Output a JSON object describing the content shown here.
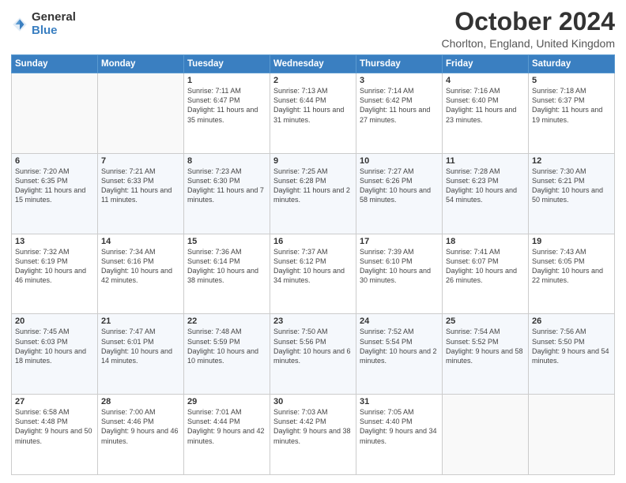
{
  "header": {
    "logo_general": "General",
    "logo_blue": "Blue",
    "month_title": "October 2024",
    "location": "Chorlton, England, United Kingdom"
  },
  "days_of_week": [
    "Sunday",
    "Monday",
    "Tuesday",
    "Wednesday",
    "Thursday",
    "Friday",
    "Saturday"
  ],
  "weeks": [
    [
      {
        "num": "",
        "info": ""
      },
      {
        "num": "",
        "info": ""
      },
      {
        "num": "1",
        "info": "Sunrise: 7:11 AM\nSunset: 6:47 PM\nDaylight: 11 hours and 35 minutes."
      },
      {
        "num": "2",
        "info": "Sunrise: 7:13 AM\nSunset: 6:44 PM\nDaylight: 11 hours and 31 minutes."
      },
      {
        "num": "3",
        "info": "Sunrise: 7:14 AM\nSunset: 6:42 PM\nDaylight: 11 hours and 27 minutes."
      },
      {
        "num": "4",
        "info": "Sunrise: 7:16 AM\nSunset: 6:40 PM\nDaylight: 11 hours and 23 minutes."
      },
      {
        "num": "5",
        "info": "Sunrise: 7:18 AM\nSunset: 6:37 PM\nDaylight: 11 hours and 19 minutes."
      }
    ],
    [
      {
        "num": "6",
        "info": "Sunrise: 7:20 AM\nSunset: 6:35 PM\nDaylight: 11 hours and 15 minutes."
      },
      {
        "num": "7",
        "info": "Sunrise: 7:21 AM\nSunset: 6:33 PM\nDaylight: 11 hours and 11 minutes."
      },
      {
        "num": "8",
        "info": "Sunrise: 7:23 AM\nSunset: 6:30 PM\nDaylight: 11 hours and 7 minutes."
      },
      {
        "num": "9",
        "info": "Sunrise: 7:25 AM\nSunset: 6:28 PM\nDaylight: 11 hours and 2 minutes."
      },
      {
        "num": "10",
        "info": "Sunrise: 7:27 AM\nSunset: 6:26 PM\nDaylight: 10 hours and 58 minutes."
      },
      {
        "num": "11",
        "info": "Sunrise: 7:28 AM\nSunset: 6:23 PM\nDaylight: 10 hours and 54 minutes."
      },
      {
        "num": "12",
        "info": "Sunrise: 7:30 AM\nSunset: 6:21 PM\nDaylight: 10 hours and 50 minutes."
      }
    ],
    [
      {
        "num": "13",
        "info": "Sunrise: 7:32 AM\nSunset: 6:19 PM\nDaylight: 10 hours and 46 minutes."
      },
      {
        "num": "14",
        "info": "Sunrise: 7:34 AM\nSunset: 6:16 PM\nDaylight: 10 hours and 42 minutes."
      },
      {
        "num": "15",
        "info": "Sunrise: 7:36 AM\nSunset: 6:14 PM\nDaylight: 10 hours and 38 minutes."
      },
      {
        "num": "16",
        "info": "Sunrise: 7:37 AM\nSunset: 6:12 PM\nDaylight: 10 hours and 34 minutes."
      },
      {
        "num": "17",
        "info": "Sunrise: 7:39 AM\nSunset: 6:10 PM\nDaylight: 10 hours and 30 minutes."
      },
      {
        "num": "18",
        "info": "Sunrise: 7:41 AM\nSunset: 6:07 PM\nDaylight: 10 hours and 26 minutes."
      },
      {
        "num": "19",
        "info": "Sunrise: 7:43 AM\nSunset: 6:05 PM\nDaylight: 10 hours and 22 minutes."
      }
    ],
    [
      {
        "num": "20",
        "info": "Sunrise: 7:45 AM\nSunset: 6:03 PM\nDaylight: 10 hours and 18 minutes."
      },
      {
        "num": "21",
        "info": "Sunrise: 7:47 AM\nSunset: 6:01 PM\nDaylight: 10 hours and 14 minutes."
      },
      {
        "num": "22",
        "info": "Sunrise: 7:48 AM\nSunset: 5:59 PM\nDaylight: 10 hours and 10 minutes."
      },
      {
        "num": "23",
        "info": "Sunrise: 7:50 AM\nSunset: 5:56 PM\nDaylight: 10 hours and 6 minutes."
      },
      {
        "num": "24",
        "info": "Sunrise: 7:52 AM\nSunset: 5:54 PM\nDaylight: 10 hours and 2 minutes."
      },
      {
        "num": "25",
        "info": "Sunrise: 7:54 AM\nSunset: 5:52 PM\nDaylight: 9 hours and 58 minutes."
      },
      {
        "num": "26",
        "info": "Sunrise: 7:56 AM\nSunset: 5:50 PM\nDaylight: 9 hours and 54 minutes."
      }
    ],
    [
      {
        "num": "27",
        "info": "Sunrise: 6:58 AM\nSunset: 4:48 PM\nDaylight: 9 hours and 50 minutes."
      },
      {
        "num": "28",
        "info": "Sunrise: 7:00 AM\nSunset: 4:46 PM\nDaylight: 9 hours and 46 minutes."
      },
      {
        "num": "29",
        "info": "Sunrise: 7:01 AM\nSunset: 4:44 PM\nDaylight: 9 hours and 42 minutes."
      },
      {
        "num": "30",
        "info": "Sunrise: 7:03 AM\nSunset: 4:42 PM\nDaylight: 9 hours and 38 minutes."
      },
      {
        "num": "31",
        "info": "Sunrise: 7:05 AM\nSunset: 4:40 PM\nDaylight: 9 hours and 34 minutes."
      },
      {
        "num": "",
        "info": ""
      },
      {
        "num": "",
        "info": ""
      }
    ]
  ]
}
